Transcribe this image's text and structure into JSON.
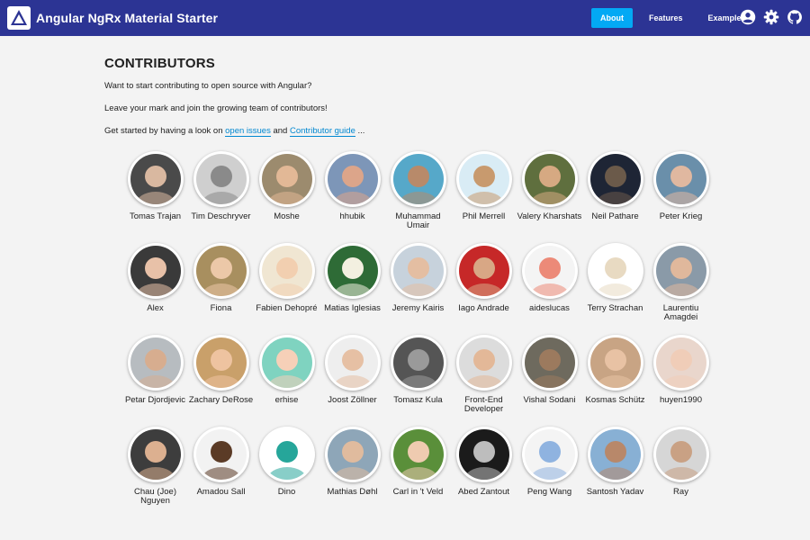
{
  "header": {
    "title": "Angular NgRx Material Starter",
    "nav": [
      "About",
      "Features",
      "Examples"
    ],
    "active_nav": "About",
    "icons": [
      "account-circle-icon",
      "settings-icon",
      "github-icon"
    ],
    "colors": {
      "toolbar": "#2c3494",
      "accent": "#03a9f4",
      "link": "#0288d1"
    }
  },
  "main": {
    "title": "CONTRIBUTORS",
    "intro1": "Want to start contributing to open source with Angular?",
    "intro2": "Leave your mark and join the growing team of contributors!",
    "intro3_prefix": "Get started by having a look on ",
    "intro3_link1": "open issues",
    "intro3_and": " and ",
    "intro3_link2": "Contributor guide",
    "intro3_suffix": " ..."
  },
  "contributors": [
    {
      "name": "Tomas Trajan",
      "bg": "#4a4a4a",
      "skin": "#d9b8a0"
    },
    {
      "name": "Tim Deschryver",
      "bg": "#cfcfcf",
      "skin": "#8a8a8a"
    },
    {
      "name": "Moshe",
      "bg": "#9c8b6e",
      "skin": "#e2b896"
    },
    {
      "name": "hhubik",
      "bg": "#7d96b8",
      "skin": "#dca58a"
    },
    {
      "name": "Muhammad Umair",
      "bg": "#56a8c9",
      "skin": "#b88a6a"
    },
    {
      "name": "Phil Merrell",
      "bg": "#d9ecf5",
      "skin": "#c89a6e"
    },
    {
      "name": "Valery Kharshats",
      "bg": "#5f6f3e",
      "skin": "#d6a982"
    },
    {
      "name": "Neil Pathare",
      "bg": "#1e2535",
      "skin": "#6b5a4a"
    },
    {
      "name": "Peter Krieg",
      "bg": "#6a8faa",
      "skin": "#e0b8a0"
    },
    {
      "name": "Alex",
      "bg": "#3a3a3a",
      "skin": "#e8c1a8"
    },
    {
      "name": "Fiona",
      "bg": "#a88f5f",
      "skin": "#ecc8a8"
    },
    {
      "name": "Fabien Dehopré",
      "bg": "#f0e6d2",
      "skin": "#f2cfb0"
    },
    {
      "name": "Matias Iglesias",
      "bg": "#2e6b36",
      "skin": "#f3f0e0"
    },
    {
      "name": "Jeremy Kairis",
      "bg": "#c7d2dc",
      "skin": "#e4bea2"
    },
    {
      "name": "Iago Andrade",
      "bg": "#c62828",
      "skin": "#d8a785"
    },
    {
      "name": "aideslucas",
      "bg": "#f4f4f4",
      "skin": "#ec8a78"
    },
    {
      "name": "Terry Strachan",
      "bg": "#ffffff",
      "skin": "#e8dac2"
    },
    {
      "name": "Laurentiu Amagdei",
      "bg": "#8a9aa8",
      "skin": "#e0b89c"
    },
    {
      "name": "Petar Djordjevic",
      "bg": "#b7bcc0",
      "skin": "#d7ad8f"
    },
    {
      "name": "Zachary DeRose",
      "bg": "#c9a06a",
      "skin": "#eec3a0"
    },
    {
      "name": "erhise",
      "bg": "#7fd3c0",
      "skin": "#f6d0b8"
    },
    {
      "name": "Joost Zöllner",
      "bg": "#eeeeee",
      "skin": "#e6c0a4"
    },
    {
      "name": "Tomasz Kula",
      "bg": "#555555",
      "skin": "#9a9a9a"
    },
    {
      "name": "Front-End Developer",
      "bg": "#dcdcdc",
      "skin": "#e3b898"
    },
    {
      "name": "Vishal Sodani",
      "bg": "#6e6a5e",
      "skin": "#9c7a5e"
    },
    {
      "name": "Kosmas Schütz",
      "bg": "#c8a484",
      "skin": "#e8c2a4"
    },
    {
      "name": "huyen1990",
      "bg": "#e9d6cc",
      "skin": "#f0cdb8"
    },
    {
      "name": "Chau (Joe) Nguyen",
      "bg": "#3d3d3d",
      "skin": "#dcb090"
    },
    {
      "name": "Amadou Sall",
      "bg": "#f2f2f2",
      "skin": "#5b3b26"
    },
    {
      "name": "Dino",
      "bg": "#ffffff",
      "skin": "#26a69a"
    },
    {
      "name": "Mathias Døhl",
      "bg": "#8ea6b8",
      "skin": "#e0bb9e"
    },
    {
      "name": "Carl in 't Veld",
      "bg": "#5a8f3a",
      "skin": "#efcbb0"
    },
    {
      "name": "Abed Zantout",
      "bg": "#1b1b1b",
      "skin": "#bdbdbd"
    },
    {
      "name": "Peng Wang",
      "bg": "#f4f4f4",
      "skin": "#8fb3e0"
    },
    {
      "name": "Santosh Yadav",
      "bg": "#88b0d4",
      "skin": "#b8886a"
    },
    {
      "name": "Ray",
      "bg": "#d6d6d6",
      "skin": "#c9a184"
    }
  ]
}
